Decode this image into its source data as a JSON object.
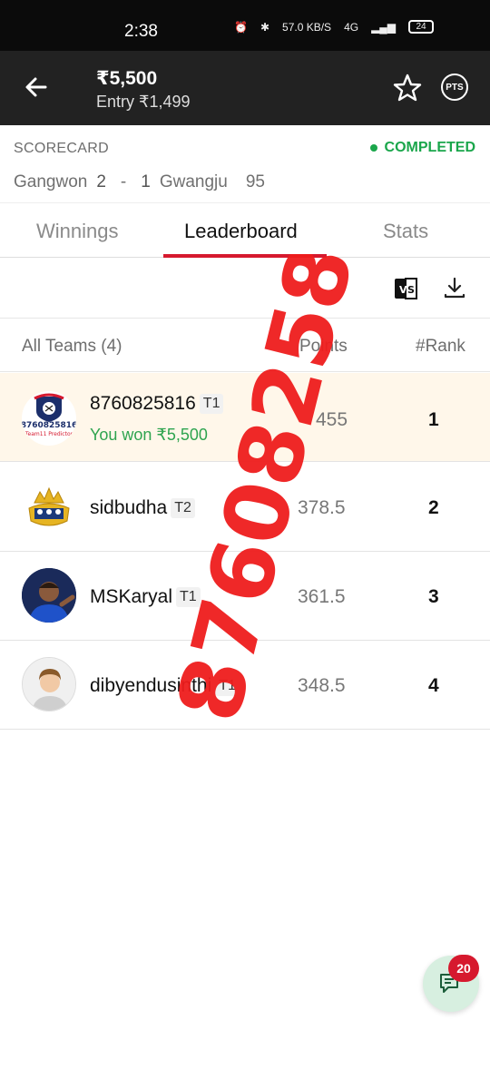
{
  "status_bar": {
    "time": "2:38",
    "net_speed": "57.0 KB/S",
    "network": "4G",
    "battery": "24"
  },
  "header": {
    "prize": "₹5,500",
    "entry": "Entry ₹1,499",
    "pts_label": "PTS",
    "icons": [
      "back-arrow-icon",
      "star-icon"
    ]
  },
  "scorecard": {
    "label": "SCORECARD",
    "status": "COMPLETED",
    "team_a": "Gangwon",
    "score_a": "2",
    "separator": "-",
    "score_b": "1",
    "team_b": "Gwangju",
    "minute": "95"
  },
  "tabs": [
    {
      "label": "Winnings"
    },
    {
      "label": "Leaderboard"
    },
    {
      "label": "Stats"
    }
  ],
  "toolbar": {
    "icons": [
      "compare-vs-icon",
      "download-icon"
    ]
  },
  "list_header": {
    "teams": "All Teams (4)",
    "points": "Points",
    "rank": "#Rank"
  },
  "rows": [
    {
      "name": "8760825816",
      "tag": "T1",
      "won": "You won ₹5,500",
      "points": "455",
      "rank": "1",
      "avatar_text": "8760825816",
      "avatar_sub": "Team11 Predictor"
    },
    {
      "name": "sidbudha",
      "tag": "T2",
      "points": "378.5",
      "rank": "2"
    },
    {
      "name": "MSKaryal",
      "tag": "T1",
      "points": "361.5",
      "rank": "3"
    },
    {
      "name": "dibyendusinthi",
      "tag": "T1",
      "points": "348.5",
      "rank": "4"
    }
  ],
  "watermark": "8760825816",
  "chat": {
    "badge": "20"
  },
  "colors": {
    "accent": "#d6192e",
    "success": "#1aa64b",
    "header_bg": "#222222",
    "highlight_row": "#fff7ea"
  }
}
